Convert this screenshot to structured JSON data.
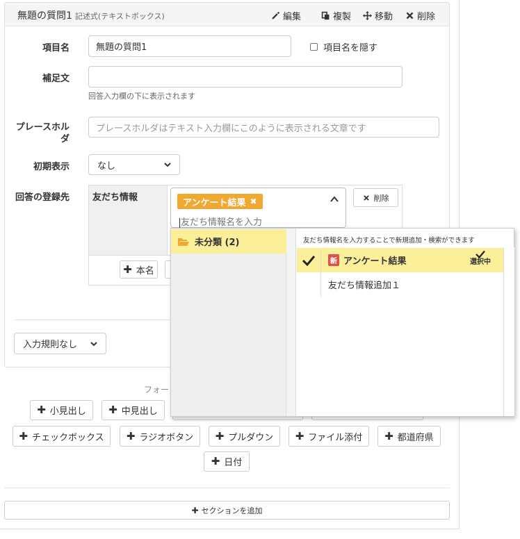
{
  "question": {
    "title": "無題の質問1",
    "type": "記述式(テキストボックス)",
    "actions": {
      "edit": "編集",
      "duplicate": "複製",
      "move": "移動",
      "delete": "削除"
    }
  },
  "fields": {
    "item_name": {
      "label": "項目名",
      "value": "無題の質問1"
    },
    "hide_item_name": {
      "label": "項目名を隠す",
      "checked": false
    },
    "supplement": {
      "label": "補足文",
      "value": "",
      "help": "回答入力欄の下に表示されます"
    },
    "placeholder": {
      "label": "プレースホルダ",
      "value": "",
      "placeholder": "プレースホルダはテキスト入力欄にこのように表示される文章です"
    },
    "initial_display": {
      "label": "初期表示",
      "selected": "なし"
    },
    "registration": {
      "label": "回答の登録先"
    }
  },
  "registration_table": {
    "left_label": "友だち情報",
    "tag": "アンケート結果",
    "search_placeholder": "友だち情報名を入力",
    "delete_button": "削除",
    "real_name_button": "本名"
  },
  "dropdown": {
    "category": "未分類 (2)",
    "hint": "友だち情報名を入力することで新規追加・検索ができます",
    "items": [
      {
        "label": "アンケート結果",
        "badge": "新",
        "selected": true,
        "state_label": "選択中"
      },
      {
        "label": "友だち情報追加１",
        "badge": "",
        "selected": false
      }
    ]
  },
  "validation": {
    "selected": "入力規則なし"
  },
  "add_section": {
    "label": "フォー",
    "buttons_row1": [
      "小見出し",
      "中見出し"
    ],
    "buttons_row2": [
      "チェックボックス",
      "ラジオボタン",
      "プルダウン",
      "ファイル添付",
      "都道府県"
    ],
    "buttons_row3": [
      "日付"
    ],
    "add_section_button": "セクションを追加"
  },
  "colors": {
    "tag": "#f0a830",
    "selected_row": "#fbef9a",
    "new_badge": "#d9534f"
  }
}
